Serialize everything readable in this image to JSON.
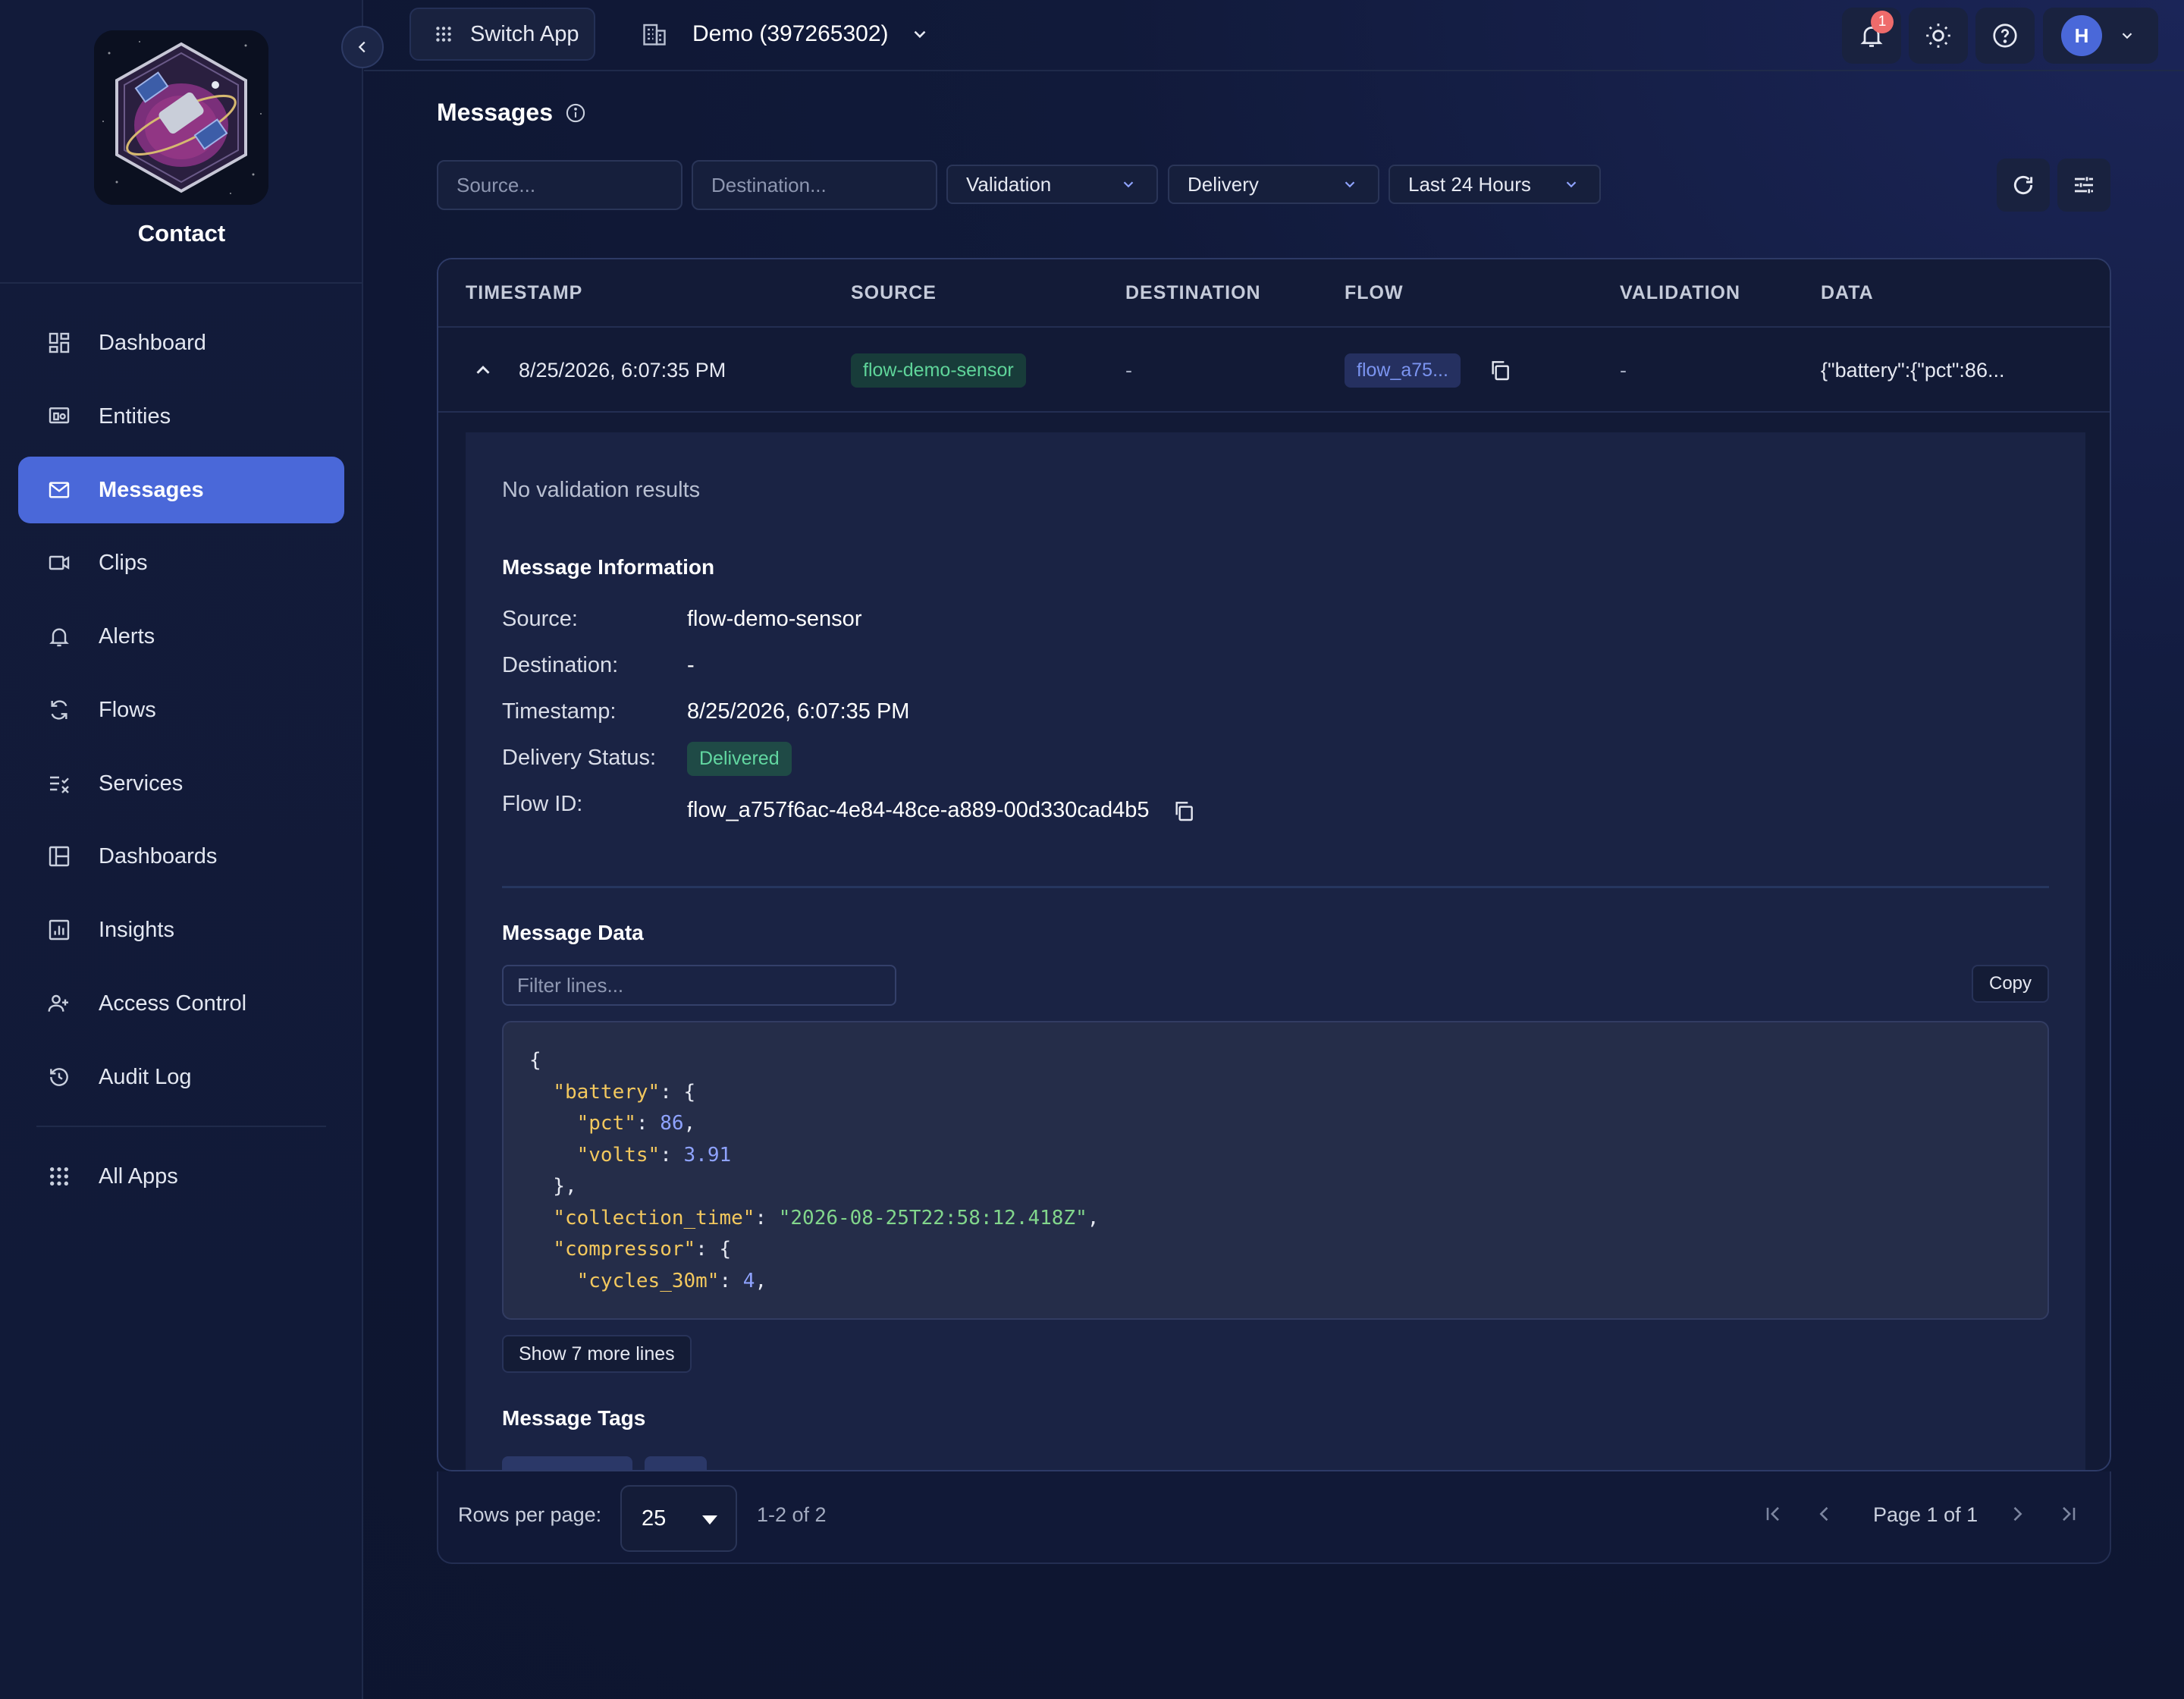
{
  "app": {
    "name": "Contact"
  },
  "topbar": {
    "switch_app_label": "Switch App",
    "org_label": "Demo (397265302)",
    "notifications_count": "1",
    "user_initial": "H"
  },
  "sidebar": {
    "items": [
      {
        "label": "Dashboard",
        "icon": "dashboard-icon"
      },
      {
        "label": "Entities",
        "icon": "entities-icon"
      },
      {
        "label": "Messages",
        "icon": "mail-icon",
        "active": true
      },
      {
        "label": "Clips",
        "icon": "video-icon"
      },
      {
        "label": "Alerts",
        "icon": "bell-icon"
      },
      {
        "label": "Flows",
        "icon": "refresh-icon"
      },
      {
        "label": "Services",
        "icon": "services-icon"
      },
      {
        "label": "Dashboards",
        "icon": "dashboards-icon"
      },
      {
        "label": "Insights",
        "icon": "insights-icon"
      },
      {
        "label": "Access Control",
        "icon": "users-icon"
      },
      {
        "label": "Audit Log",
        "icon": "history-icon"
      }
    ],
    "all_apps_label": "All Apps"
  },
  "page": {
    "title": "Messages",
    "filters": {
      "source_placeholder": "Source...",
      "destination_placeholder": "Destination...",
      "validation_label": "Validation",
      "delivery_label": "Delivery",
      "time_range_label": "Last 24 Hours"
    }
  },
  "table": {
    "columns": [
      "TIMESTAMP",
      "SOURCE",
      "DESTINATION",
      "FLOW",
      "VALIDATION",
      "DATA"
    ],
    "rows": [
      {
        "timestamp": "8/25/2026, 6:07:35 PM",
        "source": "flow-demo-sensor",
        "destination": "-",
        "flow": "flow_a75...",
        "validation": "-",
        "data": "{\"battery\":{\"pct\":86..."
      }
    ]
  },
  "detail": {
    "no_validation": "No validation results",
    "info_title": "Message Information",
    "labels": {
      "source": "Source:",
      "destination": "Destination:",
      "timestamp": "Timestamp:",
      "delivery_status": "Delivery Status:",
      "flow_id": "Flow ID:"
    },
    "values": {
      "source": "flow-demo-sensor",
      "destination": "-",
      "timestamp": "8/25/2026, 6:07:35 PM",
      "delivery_status": "Delivered",
      "flow_id": "flow_a757f6ac-4e84-48ce-a889-00d330cad4b5"
    },
    "data_title": "Message Data",
    "filter_placeholder": "Filter lines...",
    "copy_label": "Copy",
    "show_more_label": "Show 7 more lines",
    "tags_title": "Message Tags"
  },
  "pagination": {
    "rows_per_page_label": "Rows per page:",
    "rows_per_page_value": "25",
    "range_label": "1-2 of 2",
    "page_label": "Page 1 of 1"
  },
  "colors": {
    "accent": "#4a68d9",
    "success": "#62d7a1",
    "json_key": "#f3c85e",
    "json_string": "#82d68c",
    "json_number": "#8fa3ff"
  }
}
